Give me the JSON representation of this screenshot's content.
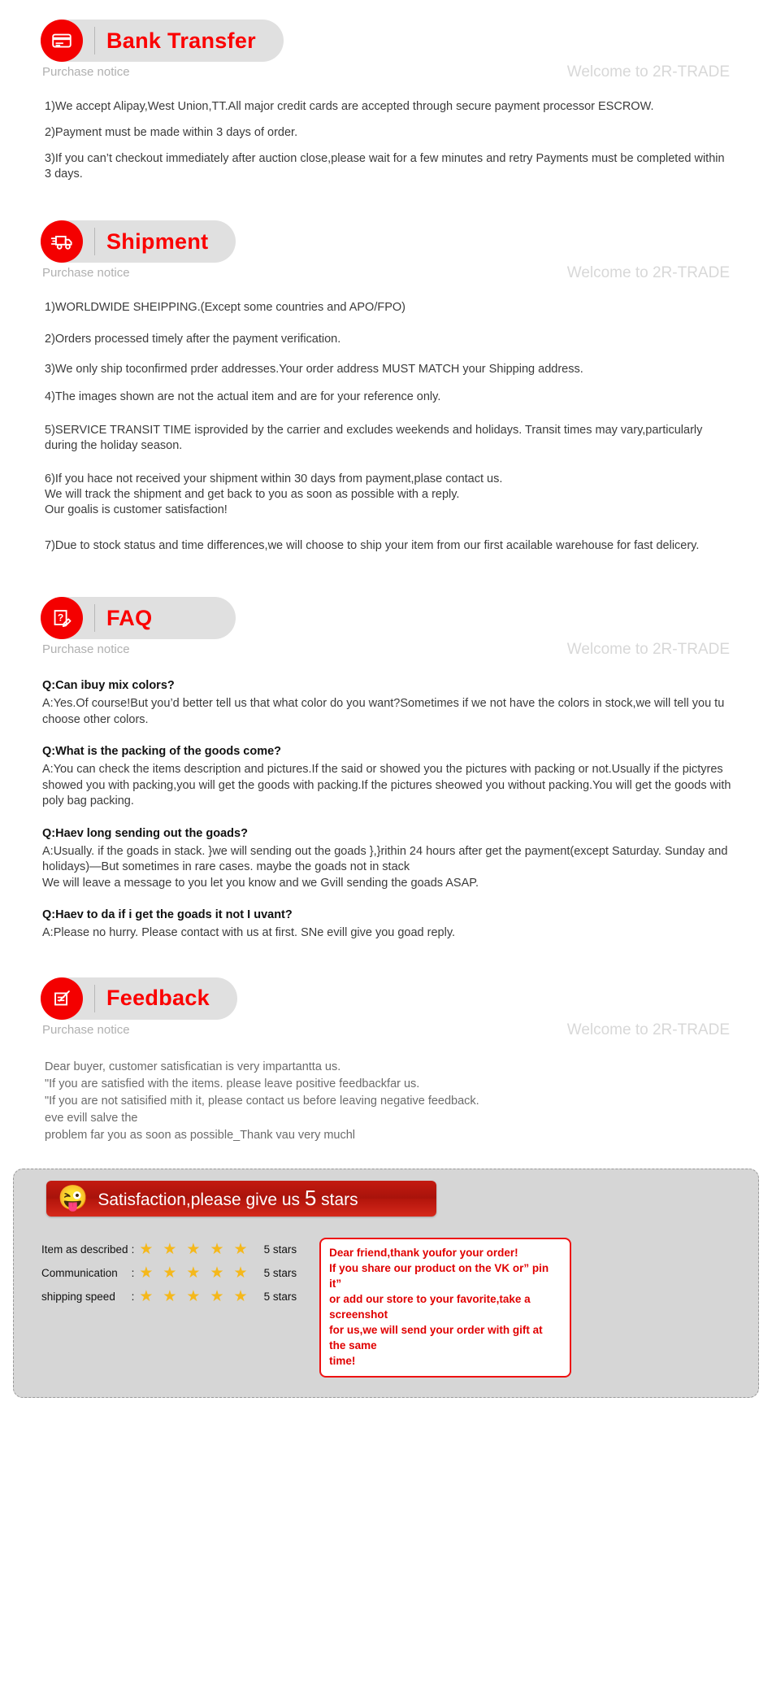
{
  "common": {
    "purchase_notice": "Purchase notice",
    "welcome": "Welcome to 2R-TRADE",
    "accent_red": "#fb0000",
    "banner_bg": "#e0e0e0"
  },
  "sections": {
    "bank": {
      "title": "Bank Transfer",
      "icon": "credit-card-icon",
      "paragraphs": [
        "1)We accept Alipay,West Union,TT.All major credit cards are accepted through secure payment processor ESCROW.",
        "2)Payment must be made within 3 days of order.",
        "3)If you can’t checkout immediately after auction close,please wait for a few minutes and retry Payments must be completed within 3 days."
      ]
    },
    "shipment": {
      "title": "Shipment",
      "icon": "delivery-truck-icon",
      "paragraphs": [
        "1)WORLDWIDE SHEIPPING.(Except some countries and APO/FPO)",
        "2)Orders processed timely after the payment verification.",
        "3)We only ship toconfirmed prder addresses.Your order address MUST MATCH your Shipping address.",
        "4)The images shown are not the actual item and are for your reference only.",
        "5)SERVICE TRANSIT TIME isprovided by the carrier and excludes weekends and holidays. Transit times may vary,particularly during the holiday season.",
        "6)If you hace not received your shipment within 30 days from payment,plase contact us.\nWe will track the shipment and get back to you as soon as possible with a reply.\nOur goalis is customer satisfaction!",
        "7)Due to stock status and time differences,we will choose to ship your item from our first acailable warehouse for fast delicery."
      ]
    },
    "faq": {
      "title": "FAQ",
      "icon": "question-document-pencil-icon",
      "items": [
        {
          "q": "Q:Can ibuy mix colors?",
          "a": "A:Yes.Of course!But you’d better tell us that what color do you want?Sometimes if we not have the colors in stock,we will tell you tu choose other colors."
        },
        {
          "q": "Q:What is the packing of the goods come?",
          "a": "A:You can check the items description and pictures.If the said or showed you the pictures with packing or not.Usually if the pictyres showed you with packing,you will get the goods with packing.If the pictures sheowed you without packing.You will get the goods with poly bag packing."
        },
        {
          "q": "Q:Haev long sending out the goads?",
          "a": "A:Usually. if the goads in stack. }we will sending out the goads },}rithin 24 hours after get the payment(except Saturday. Sunday and holidays)—But sometimes in rare cases. maybe the goads not in stack\nWe will leave a message to you let you know and we Gvill sending the goads ASAP."
        },
        {
          "q": "Q:Haev to da if i get the goads it not I uvant?",
          "a": "A:Please no hurry. Please contact with us at first. SNe evill give you goad reply."
        }
      ]
    },
    "feedback": {
      "title": "Feedback",
      "icon": "edit-document-icon",
      "lines": [
        "Dear buyer, customer satisficatian is very impartantta us.",
        "\"If you are satisfied with the items. please leave positive feedbackfar us.",
        "\"If you are not satisified mith it, please contact us before leaving negative feedback.",
        "eve evill salve the",
        "problem far you as soon as possible_Thank vau very muchl"
      ]
    }
  },
  "satisfaction": {
    "emoji": "smiley-tongue-emoji",
    "title_prefix": "Satisfaction,please give us ",
    "title_number": "5",
    "title_suffix": " stars",
    "rows": [
      {
        "label": "Item as described",
        "colon": ":",
        "stars": 5,
        "count": "5 stars"
      },
      {
        "label": "Communication",
        "colon": ":",
        "stars": 5,
        "count": "5 stars"
      },
      {
        "label": "shipping speed",
        "colon": ":",
        "stars": 5,
        "count": "5 stars"
      }
    ],
    "note": "Dear friend,thank youfor your order!\nIf you share our product on the VK or” pin it”\nor add our store to your favorite,take a screenshot\nfor us,we will send your order with gift at the same\ntime!"
  }
}
